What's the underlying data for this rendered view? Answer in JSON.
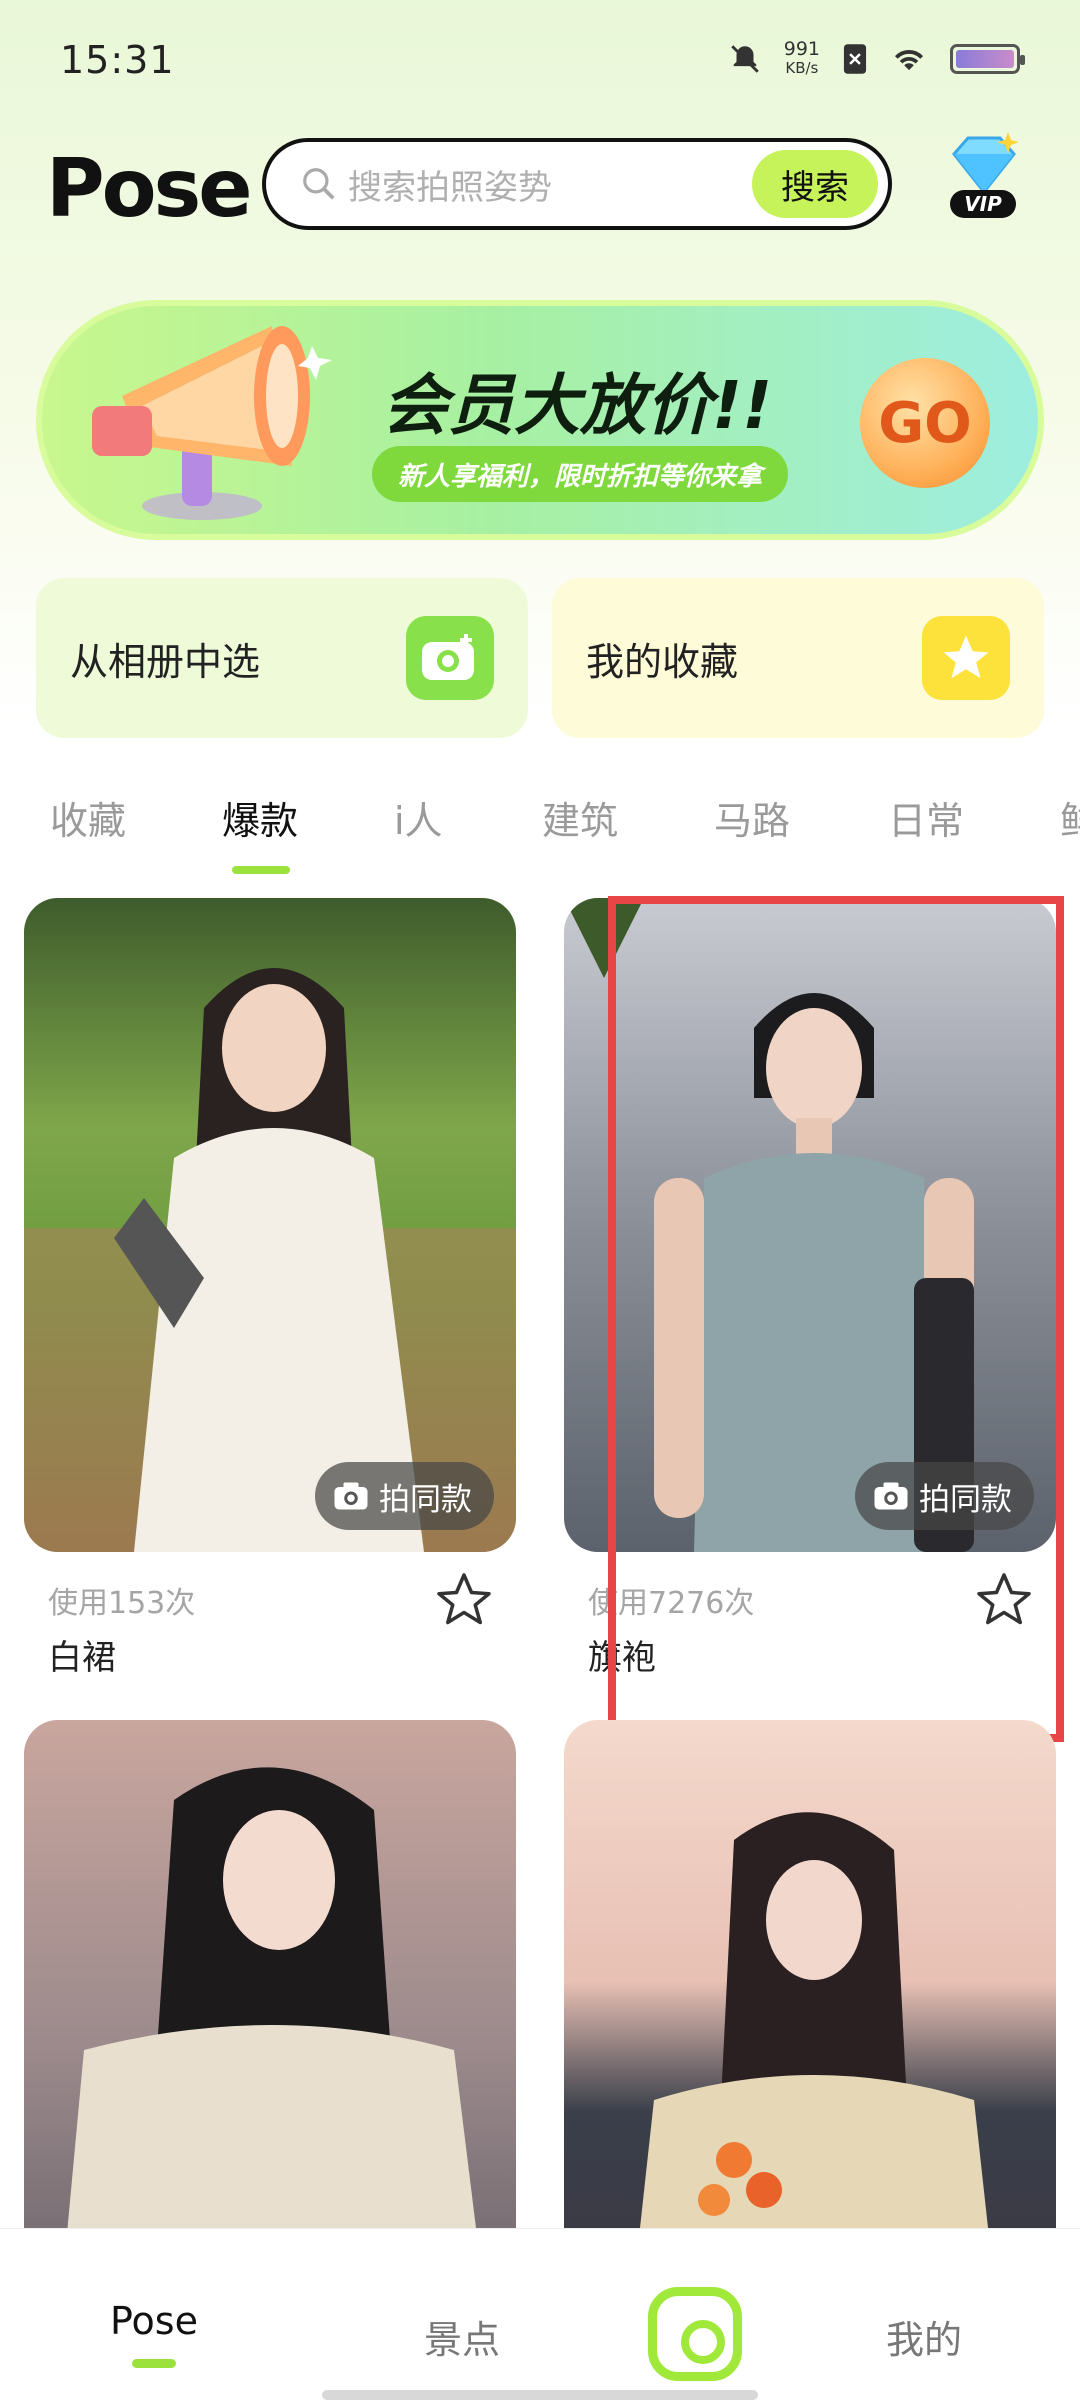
{
  "status_bar": {
    "time": "15:31",
    "net_speed_value": "991",
    "net_speed_unit": "KB/s",
    "icons": [
      "mute-bell-icon",
      "sim-off-icon",
      "wifi-icon",
      "battery-icon"
    ]
  },
  "header": {
    "logo_text": "Pose",
    "search_placeholder": "搜索拍照姿势",
    "search_button": "搜索",
    "vip_label": "VIP"
  },
  "banner": {
    "title": "会员大放价!!",
    "subtitle": "新人享福利，限时折扣等你来拿",
    "go_label": "GO"
  },
  "quick_actions": [
    {
      "label": "从相册中选",
      "icon": "camera-plus-icon"
    },
    {
      "label": "我的收藏",
      "icon": "star-icon"
    }
  ],
  "tabs": [
    {
      "label": "收藏",
      "active": false
    },
    {
      "label": "爆款",
      "active": true
    },
    {
      "label": "i人",
      "active": false
    },
    {
      "label": "建筑",
      "active": false
    },
    {
      "label": "马路",
      "active": false
    },
    {
      "label": "日常",
      "active": false
    },
    {
      "label": "鲜",
      "active": false
    }
  ],
  "cards": [
    {
      "usage": "使用153次",
      "title": "白裙",
      "shoot_label": "拍同款"
    },
    {
      "usage": "使用7276次",
      "title": "旗袍",
      "shoot_label": "拍同款"
    },
    {
      "usage": "",
      "title": "",
      "shoot_label": ""
    },
    {
      "usage": "",
      "title": "",
      "shoot_label": ""
    }
  ],
  "bottom_nav": [
    {
      "label": "Pose",
      "active": true
    },
    {
      "label": "景点",
      "active": false
    },
    {
      "label": "",
      "icon": "camera-icon",
      "active": false
    },
    {
      "label": "我的",
      "active": false
    }
  ],
  "colors": {
    "accent_green": "#9be33c",
    "search_button_bg": "#c6f25a",
    "highlight_red": "#e84646"
  }
}
